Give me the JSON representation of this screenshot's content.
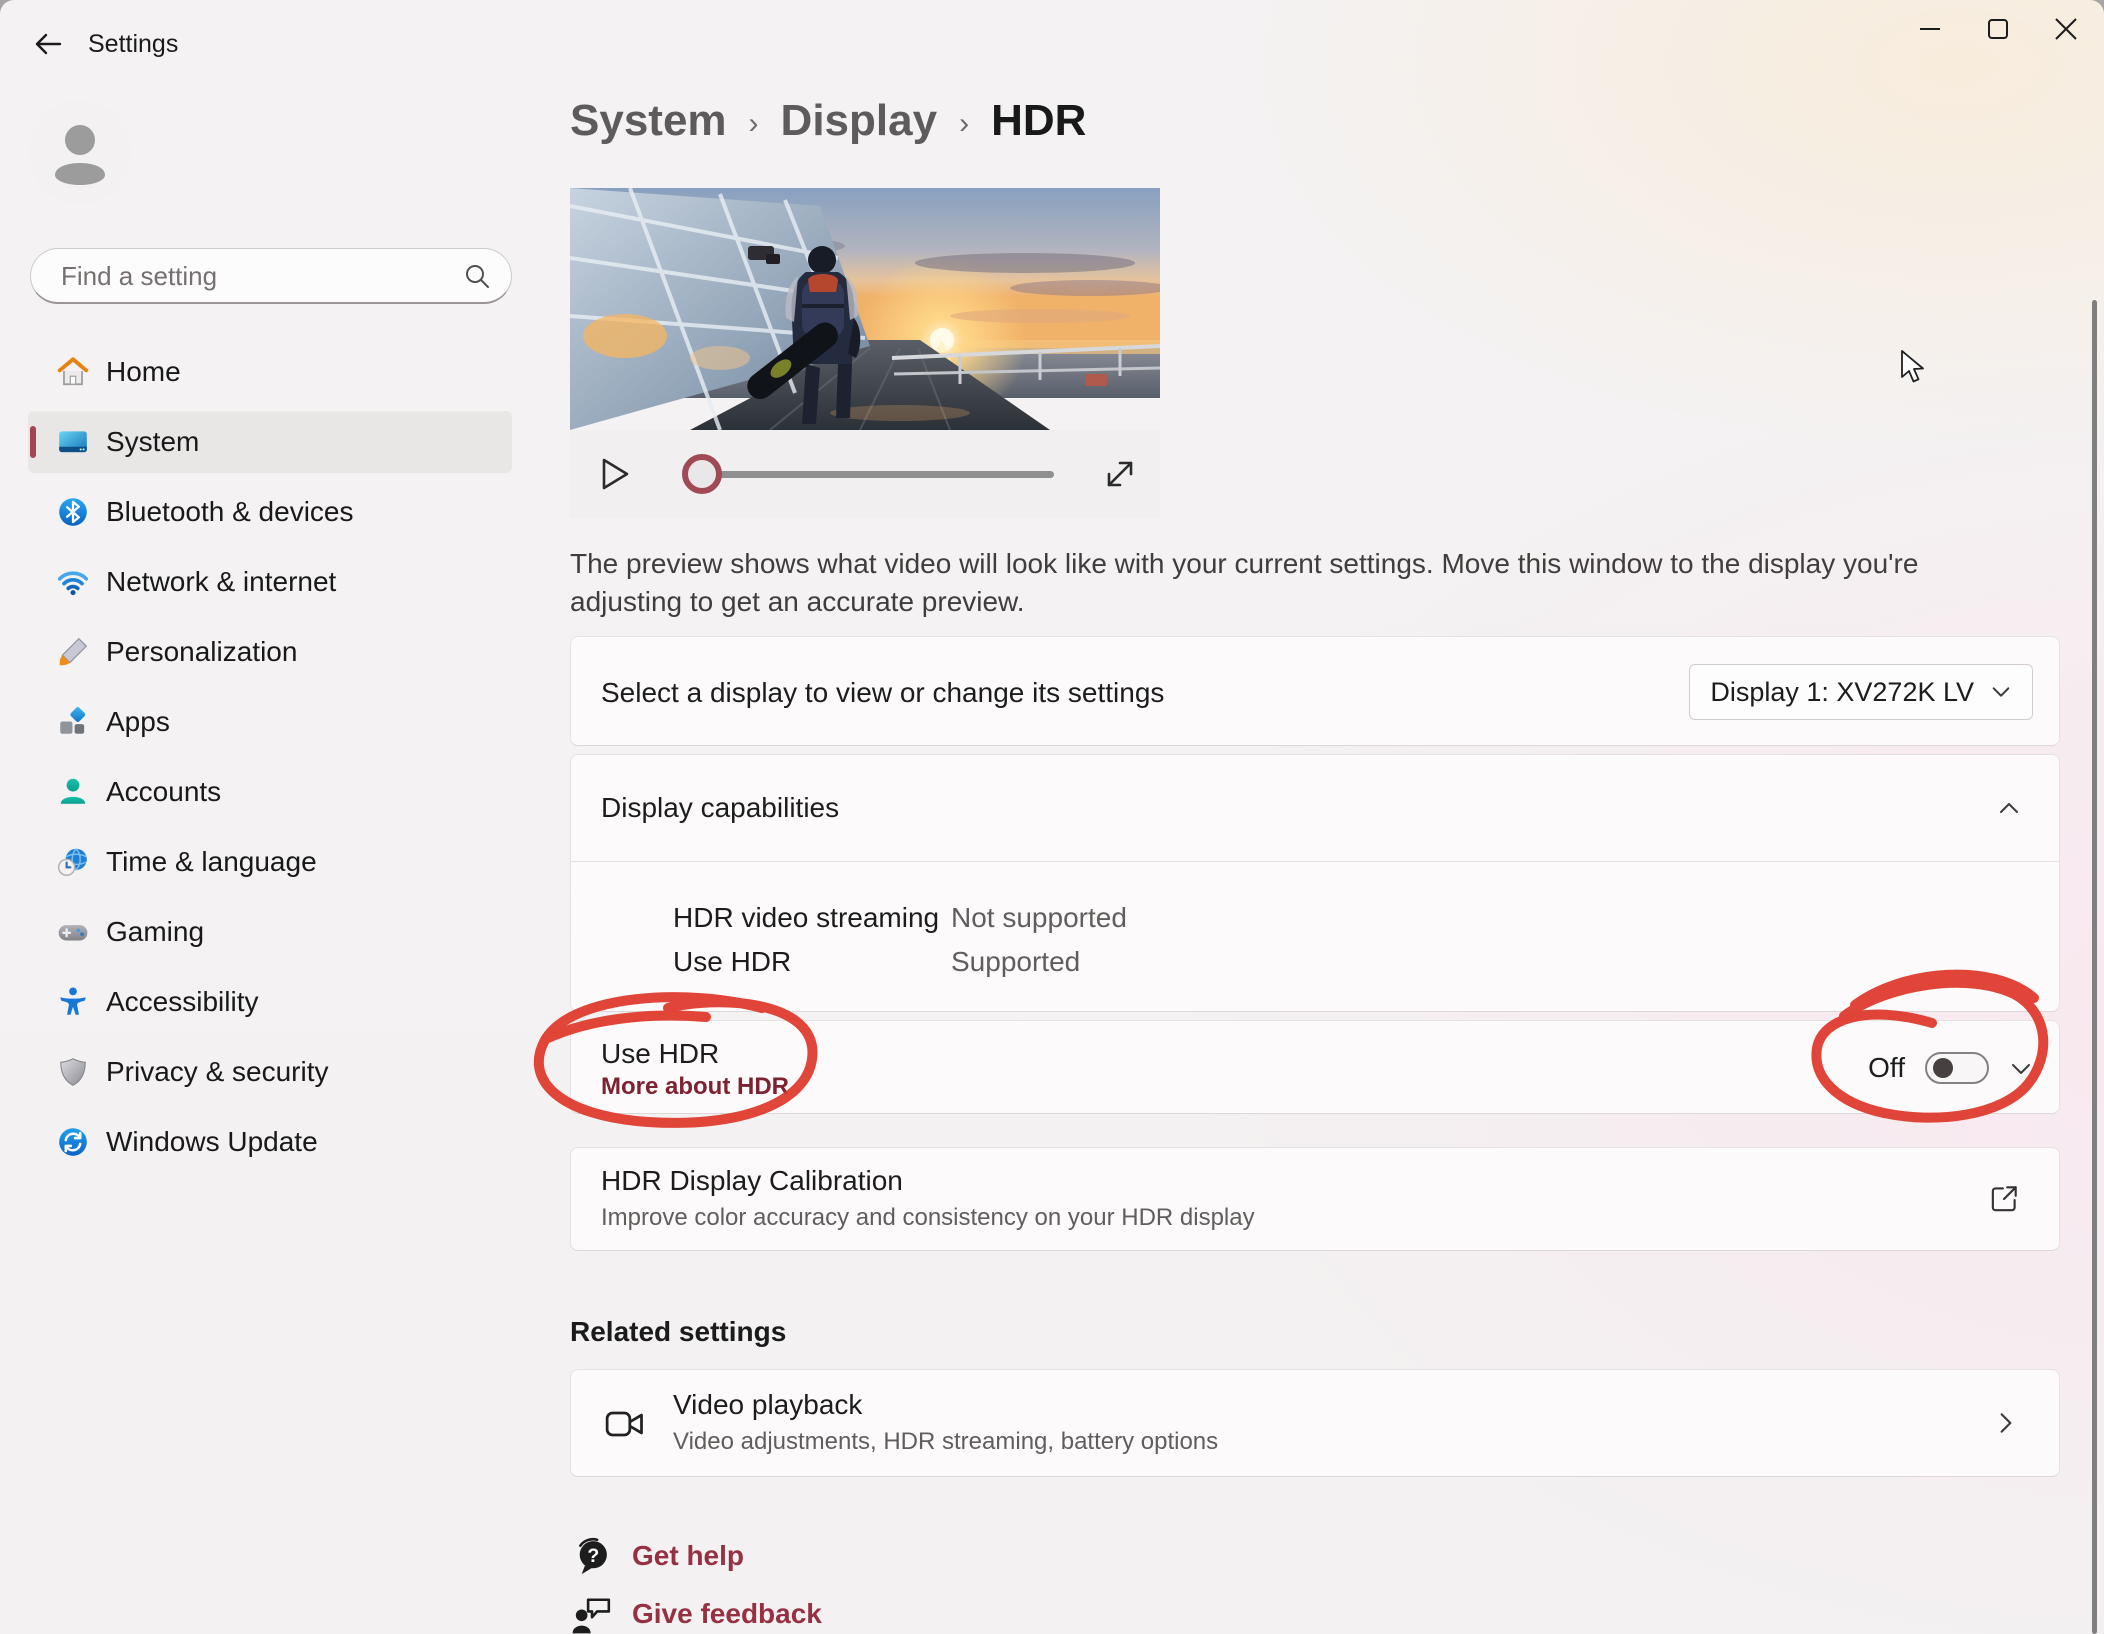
{
  "titlebar": {
    "title": "Settings"
  },
  "sidebar": {
    "search_placeholder": "Find a setting",
    "items": [
      {
        "label": "Home",
        "icon": "home-icon"
      },
      {
        "label": "System",
        "icon": "system-icon",
        "selected": true
      },
      {
        "label": "Bluetooth & devices",
        "icon": "bluetooth-icon"
      },
      {
        "label": "Network & internet",
        "icon": "network-icon"
      },
      {
        "label": "Personalization",
        "icon": "personalization-icon"
      },
      {
        "label": "Apps",
        "icon": "apps-icon"
      },
      {
        "label": "Accounts",
        "icon": "accounts-icon"
      },
      {
        "label": "Time & language",
        "icon": "time-language-icon"
      },
      {
        "label": "Gaming",
        "icon": "gaming-icon"
      },
      {
        "label": "Accessibility",
        "icon": "accessibility-icon"
      },
      {
        "label": "Privacy & security",
        "icon": "privacy-icon"
      },
      {
        "label": "Windows Update",
        "icon": "windows-update-icon"
      }
    ]
  },
  "breadcrumb": {
    "level1": "System",
    "level2": "Display",
    "level3": "HDR",
    "separator": "›"
  },
  "preview": {
    "description": "The preview shows what video will look like with your current settings. Move this window to the display you're adjusting to get an accurate preview."
  },
  "display_select": {
    "label": "Select a display to view or change its settings",
    "value": "Display 1: XV272K LV"
  },
  "capabilities": {
    "title": "Display capabilities",
    "rows": [
      {
        "label": "HDR video streaming",
        "value": "Not supported"
      },
      {
        "label": "Use HDR",
        "value": "Supported"
      }
    ]
  },
  "use_hdr": {
    "label": "Use HDR",
    "link": "More about HDR",
    "toggle_state": "Off"
  },
  "calibration": {
    "title": "HDR Display Calibration",
    "subtitle": "Improve color accuracy and consistency on your HDR display"
  },
  "related": {
    "heading": "Related settings",
    "video_playback_title": "Video playback",
    "video_playback_subtitle": "Video adjustments, HDR streaming, battery options"
  },
  "footer": {
    "get_help": "Get help",
    "give_feedback": "Give feedback"
  },
  "colors": {
    "accent_link": "#953143",
    "more_about_link": "#7d2230",
    "annotation_red": "#df382b",
    "sidebar_accent_bar": "#a24553",
    "toggle_knob": "#464040"
  }
}
